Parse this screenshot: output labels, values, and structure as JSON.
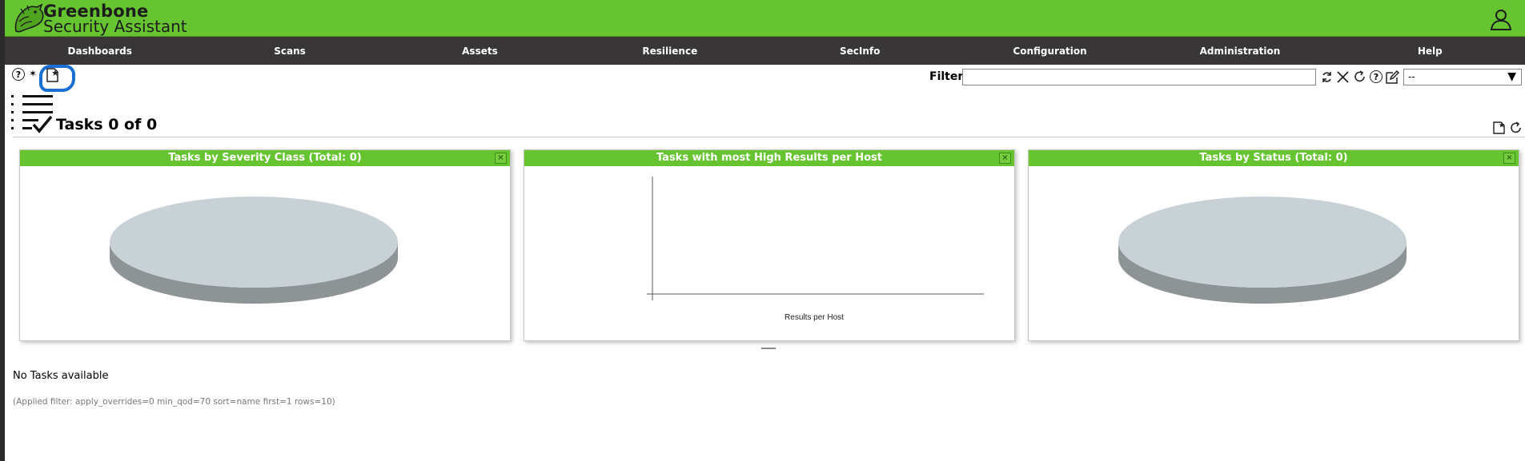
{
  "app": {
    "brand_line1": "Greenbone",
    "brand_line2": "Security Assistant"
  },
  "nav": {
    "items": [
      "Dashboards",
      "Scans",
      "Assets",
      "Resilience",
      "SecInfo",
      "Configuration",
      "Administration",
      "Help"
    ]
  },
  "toolbar": {
    "icons": [
      "help-icon",
      "wizard-icon",
      "new-task-icon"
    ]
  },
  "filter": {
    "label": "Filter",
    "value": "",
    "select_value": "--",
    "icons": [
      "refresh-filter-icon",
      "reset-filter-icon",
      "reload-icon",
      "help-icon",
      "edit-filter-icon"
    ]
  },
  "page": {
    "title": "Tasks 0 of 0",
    "empty_message": "No Tasks available",
    "applied_filter": "(Applied filter: apply_overrides=0 min_qod=70 sort=name first=1 rows=10)"
  },
  "panels": [
    {
      "title": "Tasks by Severity Class (Total: 0)",
      "close": "×"
    },
    {
      "title": "Tasks with most High Results per Host",
      "close": "×"
    },
    {
      "title": "Tasks by Status (Total: 0)",
      "close": "×"
    }
  ],
  "chart_data": [
    {
      "type": "pie",
      "title": "Tasks by Severity Class (Total: 0)",
      "values": [],
      "total": 0
    },
    {
      "type": "bar",
      "title": "Tasks with most High Results per Host",
      "xlabel": "Results per Host",
      "categories": [],
      "values": []
    },
    {
      "type": "pie",
      "title": "Tasks by Status (Total: 0)",
      "values": [],
      "total": 0
    }
  ],
  "colors": {
    "header_green": "#66c430",
    "nav_dark": "#393637",
    "empty_pie_top": "#c8d1d6",
    "empty_pie_side": "#8e9495",
    "highlight_blue": "#1a6fd1"
  }
}
